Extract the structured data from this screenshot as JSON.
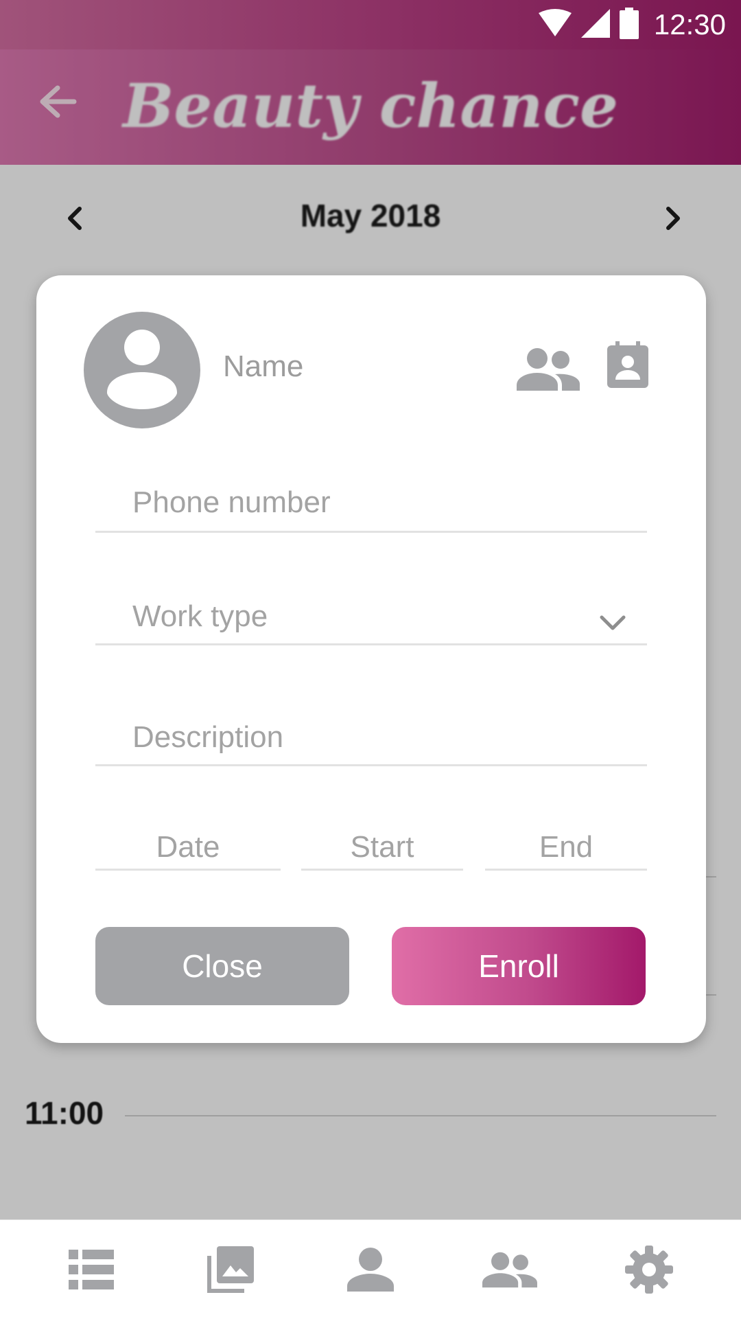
{
  "status_bar": {
    "time": "12:30"
  },
  "app_bar": {
    "title": "Beauty chance"
  },
  "calendar": {
    "month": "May 2018"
  },
  "schedule": {
    "times": [
      "11:00"
    ]
  },
  "dialog": {
    "name_label": "Name",
    "phone_placeholder": "Phone number",
    "work_type_placeholder": "Work type",
    "description_placeholder": "Description",
    "date_placeholder": "Date",
    "start_placeholder": "Start",
    "end_placeholder": "End",
    "close_label": "Close",
    "enroll_label": "Enroll"
  },
  "bottom_nav": {
    "items": [
      "list-icon",
      "gallery-icon",
      "person-icon",
      "people-icon",
      "settings-icon"
    ]
  },
  "colors": {
    "accent_start": "#e06ea7",
    "accent_end": "#a3196a",
    "muted_button": "#a3a4a7",
    "icon_gray": "#a3a4a7"
  }
}
